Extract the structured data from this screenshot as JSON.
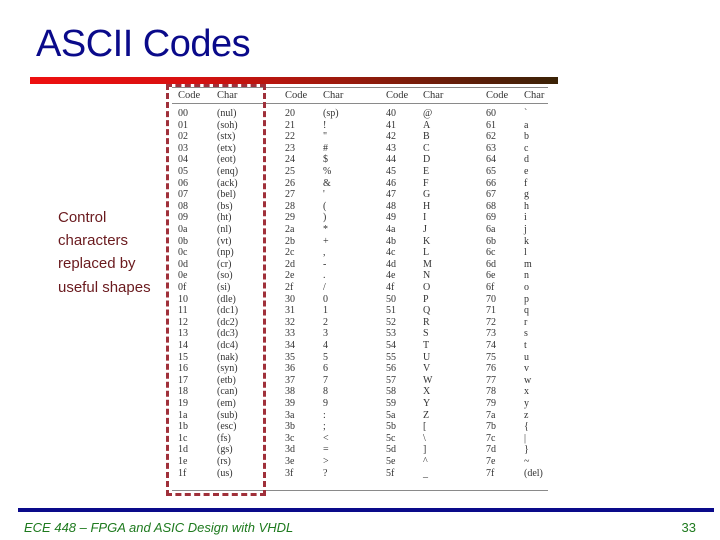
{
  "slide": {
    "title": "ASCII Codes",
    "side_note": "Control characters replaced by useful shapes",
    "footer": "ECE 448 – FPGA and ASIC Design with VHDL",
    "page_number": "33",
    "colors": {
      "title": "#0a0a8a",
      "side_note": "#6a1a1e",
      "footer": "#1e7a1e",
      "footer_line": "#0a0a8a",
      "highlight_box": "#a0303a"
    }
  },
  "table": {
    "headers": [
      "Code",
      "Char",
      "Code",
      "Char",
      "Code",
      "Char",
      "Code",
      "Char"
    ],
    "columns": [
      {
        "rows": [
          [
            "00",
            "(nul)"
          ],
          [
            "01",
            "(soh)"
          ],
          [
            "02",
            "(stx)"
          ],
          [
            "03",
            "(etx)"
          ],
          [
            "04",
            "(eot)"
          ],
          [
            "05",
            "(enq)"
          ],
          [
            "06",
            "(ack)"
          ],
          [
            "07",
            "(bel)"
          ],
          [
            "08",
            "(bs)"
          ],
          [
            "09",
            "(ht)"
          ],
          [
            "0a",
            "(nl)"
          ],
          [
            "0b",
            "(vt)"
          ],
          [
            "0c",
            "(np)"
          ],
          [
            "0d",
            "(cr)"
          ],
          [
            "0e",
            "(so)"
          ],
          [
            "0f",
            "(si)"
          ],
          [
            "10",
            "(dle)"
          ],
          [
            "11",
            "(dc1)"
          ],
          [
            "12",
            "(dc2)"
          ],
          [
            "13",
            "(dc3)"
          ],
          [
            "14",
            "(dc4)"
          ],
          [
            "15",
            "(nak)"
          ],
          [
            "16",
            "(syn)"
          ],
          [
            "17",
            "(etb)"
          ],
          [
            "18",
            "(can)"
          ],
          [
            "19",
            "(em)"
          ],
          [
            "1a",
            "(sub)"
          ],
          [
            "1b",
            "(esc)"
          ],
          [
            "1c",
            "(fs)"
          ],
          [
            "1d",
            "(gs)"
          ],
          [
            "1e",
            "(rs)"
          ],
          [
            "1f",
            "(us)"
          ]
        ]
      },
      {
        "rows": [
          [
            "20",
            "(sp)"
          ],
          [
            "21",
            "!"
          ],
          [
            "22",
            "\""
          ],
          [
            "23",
            "#"
          ],
          [
            "24",
            "$"
          ],
          [
            "25",
            "%"
          ],
          [
            "26",
            "&"
          ],
          [
            "27",
            "'"
          ],
          [
            "28",
            "("
          ],
          [
            "29",
            ")"
          ],
          [
            "2a",
            "*"
          ],
          [
            "2b",
            "+"
          ],
          [
            "2c",
            ","
          ],
          [
            "2d",
            "-"
          ],
          [
            "2e",
            "."
          ],
          [
            "2f",
            "/"
          ],
          [
            "30",
            "0"
          ],
          [
            "31",
            "1"
          ],
          [
            "32",
            "2"
          ],
          [
            "33",
            "3"
          ],
          [
            "34",
            "4"
          ],
          [
            "35",
            "5"
          ],
          [
            "36",
            "6"
          ],
          [
            "37",
            "7"
          ],
          [
            "38",
            "8"
          ],
          [
            "39",
            "9"
          ],
          [
            "3a",
            ":"
          ],
          [
            "3b",
            ";"
          ],
          [
            "3c",
            "<"
          ],
          [
            "3d",
            "="
          ],
          [
            "3e",
            ">"
          ],
          [
            "3f",
            "?"
          ]
        ]
      },
      {
        "rows": [
          [
            "40",
            "@"
          ],
          [
            "41",
            "A"
          ],
          [
            "42",
            "B"
          ],
          [
            "43",
            "C"
          ],
          [
            "44",
            "D"
          ],
          [
            "45",
            "E"
          ],
          [
            "46",
            "F"
          ],
          [
            "47",
            "G"
          ],
          [
            "48",
            "H"
          ],
          [
            "49",
            "I"
          ],
          [
            "4a",
            "J"
          ],
          [
            "4b",
            "K"
          ],
          [
            "4c",
            "L"
          ],
          [
            "4d",
            "M"
          ],
          [
            "4e",
            "N"
          ],
          [
            "4f",
            "O"
          ],
          [
            "50",
            "P"
          ],
          [
            "51",
            "Q"
          ],
          [
            "52",
            "R"
          ],
          [
            "53",
            "S"
          ],
          [
            "54",
            "T"
          ],
          [
            "55",
            "U"
          ],
          [
            "56",
            "V"
          ],
          [
            "57",
            "W"
          ],
          [
            "58",
            "X"
          ],
          [
            "59",
            "Y"
          ],
          [
            "5a",
            "Z"
          ],
          [
            "5b",
            "["
          ],
          [
            "5c",
            "\\"
          ],
          [
            "5d",
            "]"
          ],
          [
            "5e",
            "^"
          ],
          [
            "5f",
            "_"
          ]
        ]
      },
      {
        "rows": [
          [
            "60",
            "`"
          ],
          [
            "61",
            "a"
          ],
          [
            "62",
            "b"
          ],
          [
            "63",
            "c"
          ],
          [
            "64",
            "d"
          ],
          [
            "65",
            "e"
          ],
          [
            "66",
            "f"
          ],
          [
            "67",
            "g"
          ],
          [
            "68",
            "h"
          ],
          [
            "69",
            "i"
          ],
          [
            "6a",
            "j"
          ],
          [
            "6b",
            "k"
          ],
          [
            "6c",
            "l"
          ],
          [
            "6d",
            "m"
          ],
          [
            "6e",
            "n"
          ],
          [
            "6f",
            "o"
          ],
          [
            "70",
            "p"
          ],
          [
            "71",
            "q"
          ],
          [
            "72",
            "r"
          ],
          [
            "73",
            "s"
          ],
          [
            "74",
            "t"
          ],
          [
            "75",
            "u"
          ],
          [
            "76",
            "v"
          ],
          [
            "77",
            "w"
          ],
          [
            "78",
            "x"
          ],
          [
            "79",
            "y"
          ],
          [
            "7a",
            "z"
          ],
          [
            "7b",
            "{"
          ],
          [
            "7c",
            "|"
          ],
          [
            "7d",
            "}"
          ],
          [
            "7e",
            "~"
          ],
          [
            "7f",
            "(del)"
          ]
        ]
      }
    ]
  }
}
